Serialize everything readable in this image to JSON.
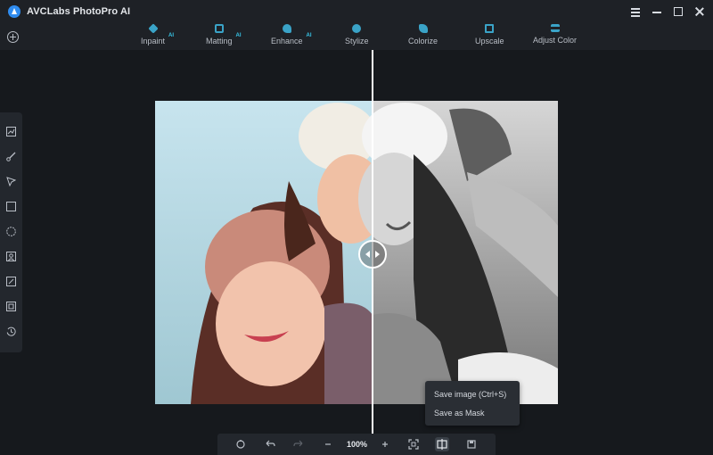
{
  "app": {
    "title": "AVCLabs PhotoPro AI"
  },
  "toolbar": {
    "tabs": [
      {
        "label": "Inpaint",
        "ai": "AI",
        "icon": "inpaint-icon",
        "color": "#3aa3c7"
      },
      {
        "label": "Matting",
        "ai": "AI",
        "icon": "matting-icon",
        "color": "#3aa3c7"
      },
      {
        "label": "Enhance",
        "ai": "AI",
        "icon": "enhance-icon",
        "color": "#3aa3c7"
      },
      {
        "label": "Stylize",
        "ai": "",
        "icon": "stylize-icon",
        "color": "#3aa3c7"
      },
      {
        "label": "Colorize",
        "ai": "",
        "icon": "colorize-icon",
        "color": "#3aa3c7"
      },
      {
        "label": "Upscale",
        "ai": "",
        "icon": "upscale-icon",
        "color": "#3aa3c7"
      },
      {
        "label": "Adjust Color",
        "ai": "",
        "icon": "adjust-color-icon",
        "color": "#3aa3c7"
      }
    ]
  },
  "left_tools": [
    "adjust-icon",
    "brush-icon",
    "select-arrow-icon",
    "rectangle-select-icon",
    "ellipse-select-icon",
    "portrait-icon",
    "auto-select-icon",
    "layers-icon",
    "history-icon"
  ],
  "bottom_bar": {
    "zoom": "100%"
  },
  "context_menu": {
    "save_image": "Save image (Ctrl+S)",
    "save_mask": "Save as Mask"
  },
  "colors": {
    "accent": "#38c6e8",
    "background": "#16191d",
    "panel": "#1e2126"
  }
}
